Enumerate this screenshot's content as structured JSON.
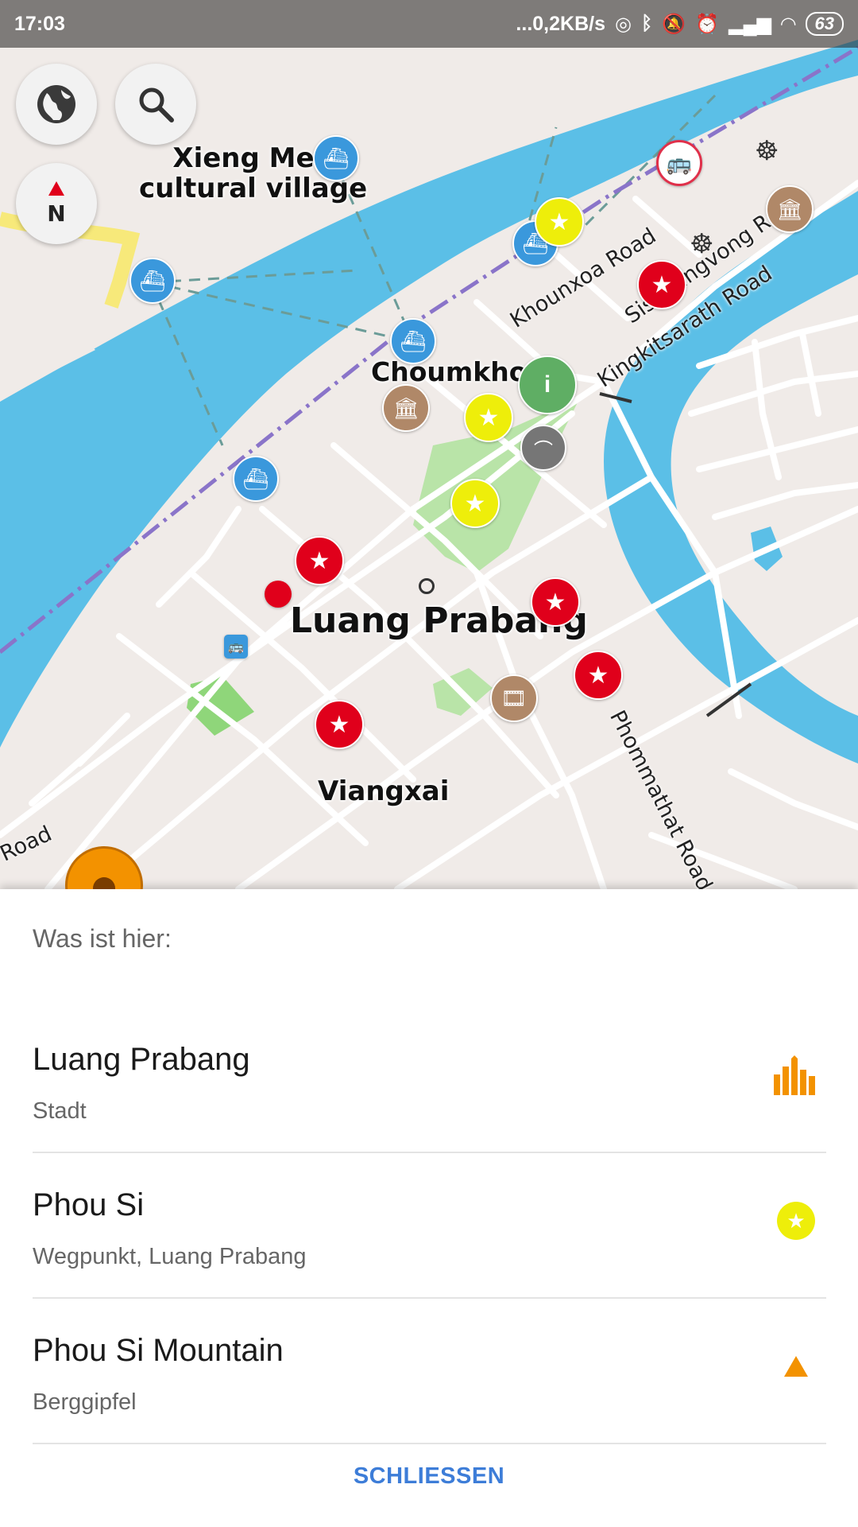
{
  "status_bar": {
    "time": "17:03",
    "network_speed": "...0,2KB/s",
    "battery": "63"
  },
  "map": {
    "controls": {
      "globe_icon": "globe-icon",
      "search_icon": "search-icon",
      "compass_label": "N"
    },
    "place_labels": {
      "xieng_men": "Xieng Men\ncultural village",
      "choumkhong": "Choumkhong",
      "luang_prabang": "Luang Prabang",
      "viangxai": "Viangxai"
    },
    "road_labels": {
      "khounxoa": "Khounxoa Road",
      "sisavangvong": "Sisavangvong Road",
      "kingkitsarath": "Kingkitsarath Road",
      "phommathat": "Phommathat Road",
      "road_left": "Road"
    },
    "colors": {
      "water": "#5bbfe7",
      "land": "#f0ebe8",
      "park": "#b9e4a8",
      "pin_red": "#e0001b",
      "pin_yellow": "#eeee0a",
      "pin_ferry": "#3a98dc",
      "pin_museum": "#b08868",
      "accent_orange": "#f39200"
    }
  },
  "sheet": {
    "title": "Was ist hier:",
    "results": [
      {
        "title": "Luang Prabang",
        "subtitle": "Stadt",
        "icon": "city-icon"
      },
      {
        "title": "Phou Si",
        "subtitle": "Wegpunkt, Luang Prabang",
        "icon": "star-waypoint-icon"
      },
      {
        "title": "Phou Si Mountain",
        "subtitle": "Berggipfel",
        "icon": "peak-icon"
      }
    ],
    "close_label": "SCHLIESSEN"
  }
}
